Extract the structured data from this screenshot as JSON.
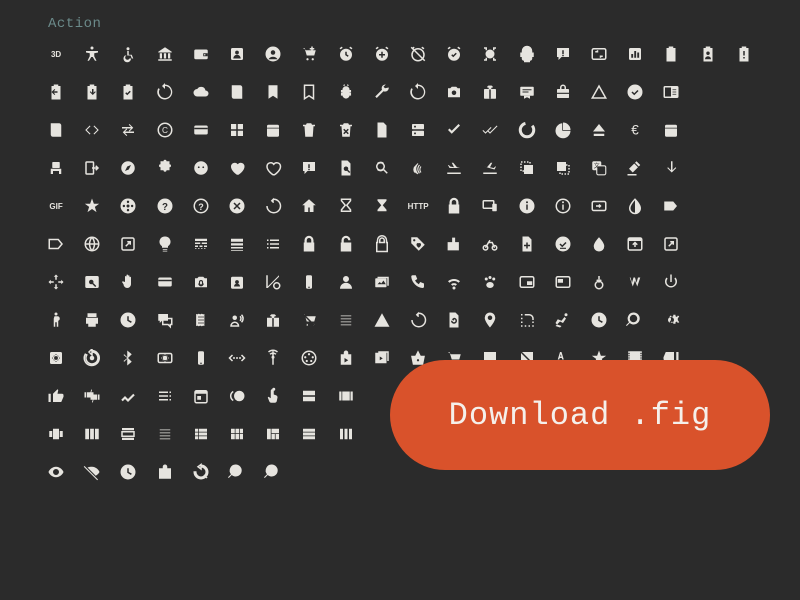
{
  "category_label": "Action",
  "download": {
    "label": "Download .fig"
  },
  "icons": [
    "3d-rotation",
    "accessibility",
    "accessible",
    "account-balance",
    "account-balance-wallet",
    "account-box",
    "account-circle",
    "add-shopping-cart",
    "alarm",
    "alarm-add",
    "alarm-off",
    "alarm-on",
    "all-out",
    "android",
    "announcement",
    "aspect-ratio",
    "assessment",
    "assignment",
    "assignment-ind",
    "assignment-late",
    "assignment-return",
    "assignment-returned",
    "assignment-turned-in",
    "autorenew",
    "backup",
    "book",
    "bookmark",
    "bookmark-border",
    "bug-report",
    "build",
    "cached",
    "camera-enhance",
    "card-giftcard",
    "card-membership",
    "card-travel",
    "change-history",
    "check-circle",
    "chrome-reader-mode",
    "class",
    "code",
    "compare-arrows",
    "copyright",
    "credit-card",
    "dashboard",
    "date-range",
    "delete",
    "delete-forever",
    "description",
    "dns",
    "done",
    "done-all",
    "donut-large",
    "donut-small",
    "eject",
    "euro-symbol",
    "event",
    "event-seat",
    "exit-to-app",
    "explore",
    "extension",
    "face",
    "favorite",
    "favorite-border",
    "feedback",
    "find-in-page",
    "find-replace",
    "fingerprint",
    "flight-land",
    "flight-takeoff",
    "flip-to-back",
    "flip-to-front",
    "g-translate",
    "gavel",
    "get-app",
    "gif",
    "grade",
    "group-work",
    "help",
    "help-outline",
    "highlight-off",
    "history",
    "home",
    "hourglass-empty",
    "hourglass-full",
    "http",
    "https",
    "important-devices",
    "info",
    "info-outline",
    "input",
    "invert-colors",
    "label",
    "label-outline",
    "language",
    "launch",
    "lightbulb-outline",
    "line-style",
    "line-weight",
    "list",
    "lock",
    "lock-open",
    "lock-outline",
    "loyalty",
    "markunread-mailbox",
    "motorcycle",
    "note-add",
    "offline-pin",
    "opacity",
    "open-in-browser",
    "open-in-new",
    "open-with",
    "pageview",
    "pan-tool",
    "payment",
    "perm-camera-mic",
    "perm-contact-calendar",
    "perm-data-setting",
    "perm-device-information",
    "perm-identity",
    "perm-media",
    "perm-phone-msg",
    "perm-scan-wifi",
    "pets",
    "picture-in-picture",
    "picture-in-picture-alt",
    "play-for-work",
    "polymer",
    "power-settings-new",
    "pregnant-woman",
    "print",
    "query-builder",
    "question-answer",
    "receipt",
    "record-voice-over",
    "redeem",
    "remove-shopping-cart",
    "reorder",
    "report-problem",
    "restore",
    "restore-page",
    "room",
    "rounded-corner",
    "rowing",
    "schedule",
    "search",
    "settings",
    "settings-applications",
    "settings-backup-restore",
    "settings-bluetooth",
    "settings-brightness",
    "settings-cell",
    "settings-ethernet",
    "settings-input-antenna",
    "settings-input-svideo",
    "shop",
    "shop-two",
    "shopping-basket",
    "shopping-cart",
    "speaker-notes",
    "speaker-notes-off",
    "spellcheck",
    "star-rate",
    "theaters",
    "thumb-down",
    "thumb-up",
    "thumbs-up-down",
    "timeline",
    "toc",
    "today",
    "toll",
    "touch-app",
    "view-agenda",
    "view-array",
    "view-carousel",
    "view-column",
    "view-day",
    "view-headline",
    "view-list",
    "view-module",
    "view-quilt",
    "view-stream",
    "view-week",
    "visibility",
    "visibility-off",
    "watch-later",
    "work",
    "youtube-searched-for",
    "zoom-in",
    "zoom-out"
  ],
  "text_badges": {
    "3d-rotation": "3D",
    "gif": "GIF",
    "http": "HTTP"
  }
}
